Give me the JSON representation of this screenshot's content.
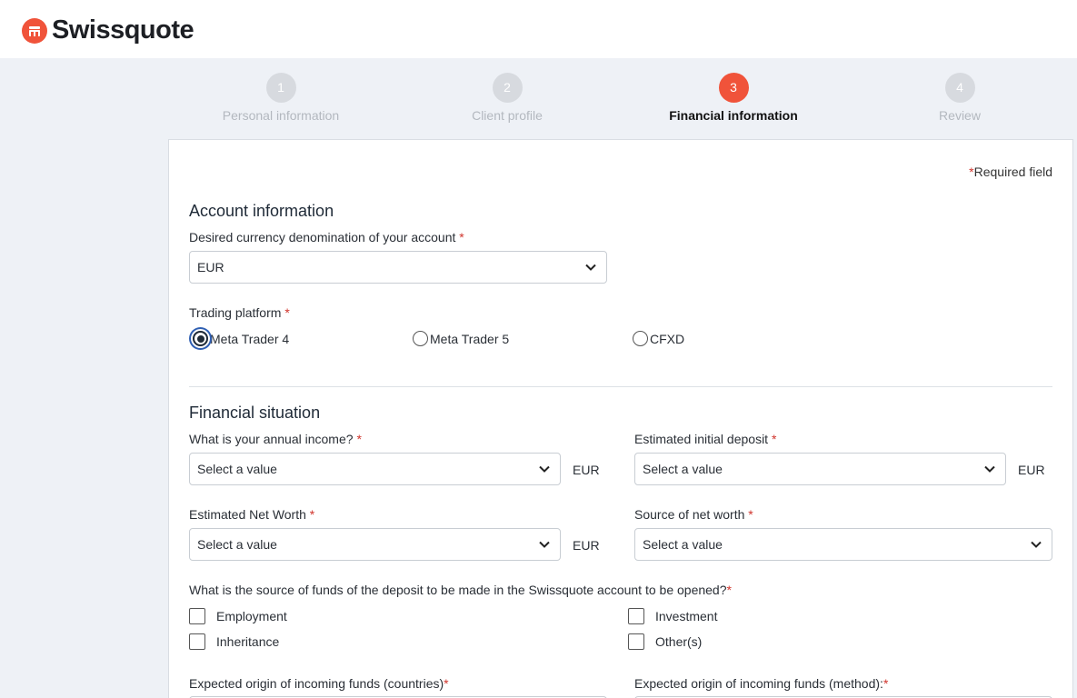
{
  "brand": {
    "name": "Swissquote",
    "color": "#f0533a"
  },
  "stepper": {
    "steps": [
      {
        "number": "1",
        "label": "Personal information",
        "state": "inactive"
      },
      {
        "number": "2",
        "label": "Client profile",
        "state": "inactive"
      },
      {
        "number": "3",
        "label": "Financial information",
        "state": "active"
      },
      {
        "number": "4",
        "label": "Review",
        "state": "inactive"
      }
    ]
  },
  "form": {
    "required_star": "*",
    "required_note": "Required field",
    "account": {
      "title": "Account information",
      "currency_label": "Desired currency denomination of your account",
      "currency_value": "EUR",
      "platform_label": "Trading platform",
      "platforms": [
        {
          "label": "Meta Trader 4",
          "checked": true
        },
        {
          "label": "Meta Trader 5",
          "checked": false
        },
        {
          "label": "CFXD",
          "checked": false
        }
      ]
    },
    "financial": {
      "title": "Financial situation",
      "annual_income_label": "What is your annual income?",
      "annual_income_value": "Select a value",
      "annual_income_unit": "EUR",
      "initial_deposit_label": "Estimated initial deposit",
      "initial_deposit_value": "Select a value",
      "initial_deposit_unit": "EUR",
      "net_worth_label": "Estimated Net Worth",
      "net_worth_value": "Select a value",
      "net_worth_unit": "EUR",
      "source_net_worth_label": "Source of net worth",
      "source_net_worth_value": "Select a value",
      "source_funds_label": "What is the source of funds of the deposit to be made in the Swissquote account to be opened?",
      "source_funds_options": [
        "Employment",
        "Investment",
        "Inheritance",
        "Other(s)"
      ],
      "origin_countries_label": "Expected origin of incoming funds (countries)",
      "origin_method_label": "Expected origin of incoming funds (method):"
    }
  }
}
